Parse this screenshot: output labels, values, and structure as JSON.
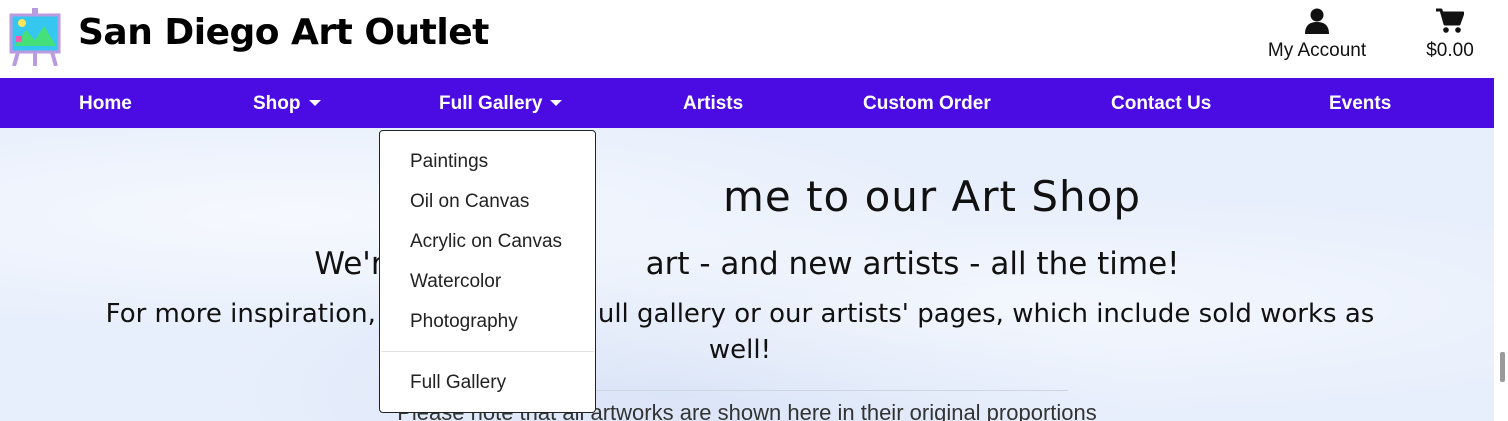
{
  "header": {
    "site_title": "San Diego Art Outlet",
    "account_label": "My Account",
    "cart_total": "$0.00"
  },
  "nav": {
    "items": [
      {
        "label": "Home"
      },
      {
        "label": "Shop"
      },
      {
        "label": "Full Gallery"
      },
      {
        "label": "Artists"
      },
      {
        "label": "Custom Order"
      },
      {
        "label": "Contact Us"
      },
      {
        "label": "Events"
      }
    ]
  },
  "dropdown": {
    "items": [
      {
        "label": "Paintings"
      },
      {
        "label": "Oil on Canvas"
      },
      {
        "label": "Acrylic on Canvas"
      },
      {
        "label": "Watercolor"
      },
      {
        "label": "Photography"
      },
      {
        "label": "Full Gallery"
      }
    ]
  },
  "main": {
    "welcome_line": "me to our Art Shop",
    "subline_left": "We'r",
    "subline_right": "art - and new artists - all the time!",
    "inspiration_left": "For more inspiration,",
    "inspiration_right": "ull gallery or our artists' pages, which include sold works as",
    "inspiration_wrap": "well!",
    "note": "Please note that all artworks are shown here in their original proportions"
  },
  "colors": {
    "nav_background": "#4a0ce3",
    "page_background": "#e8effc"
  }
}
